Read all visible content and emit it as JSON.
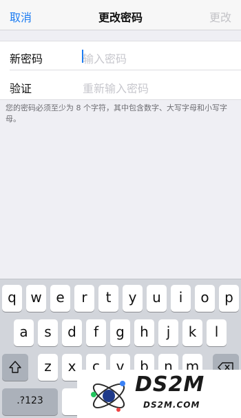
{
  "navbar": {
    "cancel": "取消",
    "title": "更改密码",
    "change": "更改"
  },
  "form": {
    "new_password_label": "新密码",
    "new_password_placeholder": "输入密码",
    "verify_label": "验证",
    "verify_placeholder": "重新输入密码"
  },
  "hint": "您的密码必须至少为 8 个字符，其中包含数字、大写字母和小写字母。",
  "keyboard": {
    "row1": [
      "q",
      "w",
      "e",
      "r",
      "t",
      "y",
      "u",
      "i",
      "o",
      "p"
    ],
    "row2": [
      "a",
      "s",
      "d",
      "f",
      "g",
      "h",
      "j",
      "k",
      "l"
    ],
    "row3": [
      "z",
      "x",
      "c",
      "v",
      "b",
      "n",
      "m"
    ],
    "numbers_key": ".?123"
  },
  "watermark": {
    "text": "DS2M",
    "sub": "DS2M.COM"
  },
  "colors": {
    "accent": "#1a7bf2",
    "disabled": "#c3c3c7",
    "background": "#efeff4"
  }
}
